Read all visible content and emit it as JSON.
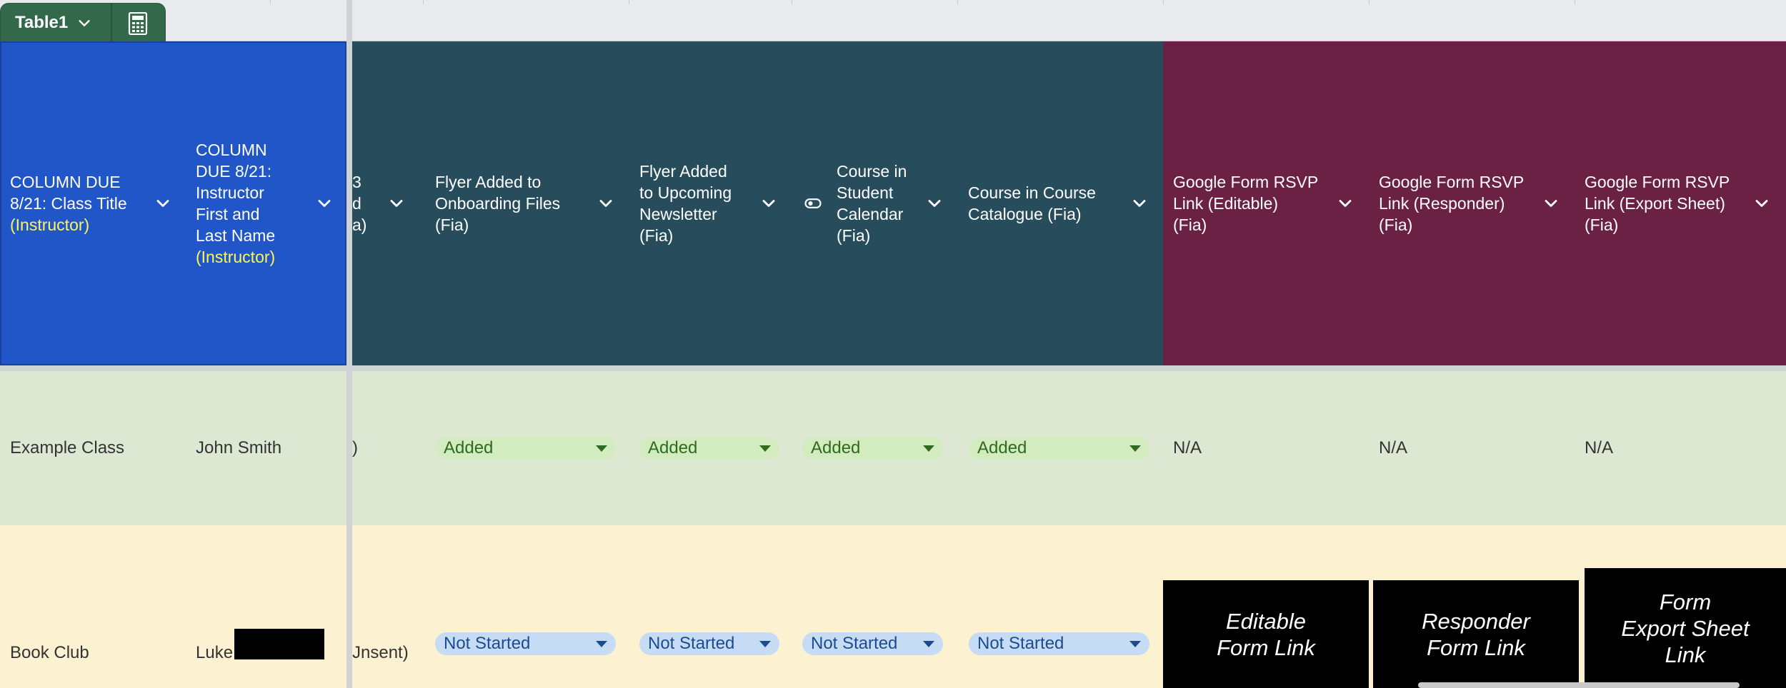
{
  "tab": {
    "name": "Table1",
    "chevron_icon": "chevron-down-icon",
    "calculator_icon": "calculator-icon"
  },
  "colors": {
    "blue_header": "#2156c9",
    "teal_header": "#274d5c",
    "maroon_header": "#6a2143",
    "row_green": "#dde8d3",
    "row_yellow": "#fcf1d0"
  },
  "headers": {
    "class_title": {
      "line1": "COLUMN DUE",
      "line2": "8/21: Class Title",
      "line3": "(Instructor)"
    },
    "instructor": {
      "line1": "COLUMN",
      "line2": "DUE 8/21:",
      "line3": "Instructor",
      "line4": "First and",
      "line5": "Last Name",
      "line6": "(Instructor)"
    },
    "partial": {
      "line1": "3",
      "line2": "d",
      "line3": "a)"
    },
    "flyer_onboarding": {
      "line1": "Flyer Added to",
      "line2": "Onboarding Files",
      "line3": "(Fia)"
    },
    "flyer_newsletter": {
      "line1": "Flyer Added",
      "line2": "to Upcoming",
      "line3": "Newsletter",
      "line4": "(Fia)"
    },
    "student_calendar": {
      "line1": "Course in",
      "line2": "Student",
      "line3": "Calendar",
      "line4": "(Fia)"
    },
    "course_catalogue": {
      "line1": "Course in Course",
      "line2": "Catalogue (Fia)"
    },
    "rsvp_editable": {
      "line1": "Google Form RSVP",
      "line2": "Link (Editable)",
      "line3": "(Fia)"
    },
    "rsvp_responder": {
      "line1": "Google Form RSVP",
      "line2": "Link (Responder)",
      "line3": "(Fia)"
    },
    "rsvp_export": {
      "line1": "Google Form RSVP",
      "line2": "Link (Export Sheet)",
      "line3": "(Fia)"
    }
  },
  "rows": [
    {
      "class_title": "Example Class",
      "instructor": "John Smith",
      "partial": ")",
      "flyer_onboarding": "Added",
      "flyer_newsletter": "Added",
      "student_calendar": "Added",
      "course_catalogue": "Added",
      "rsvp_editable": "N/A",
      "rsvp_responder": "N/A",
      "rsvp_export": "N/A"
    },
    {
      "class_title": "Book Club",
      "instructor": "Luke",
      "partial": "Jnsent)",
      "flyer_onboarding": "Not Started",
      "flyer_newsletter": "Not Started",
      "student_calendar": "Not Started",
      "course_catalogue": "Not Started",
      "rsvp_editable": {
        "line1": "Editable",
        "line2": "Form Link"
      },
      "rsvp_responder": {
        "line1": "Responder",
        "line2": "Form Link"
      },
      "rsvp_export": {
        "line1": "Form",
        "line2": "Export Sheet",
        "line3": "Link"
      }
    }
  ]
}
